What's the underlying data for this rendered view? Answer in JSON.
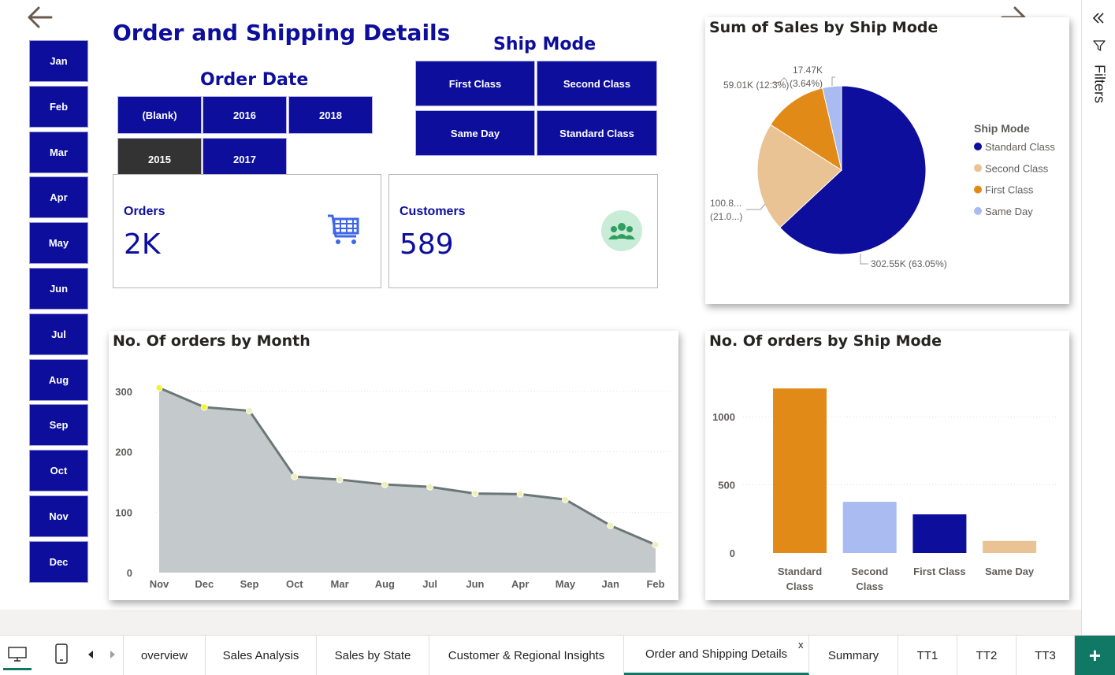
{
  "page_title": "Order and Shipping Details",
  "months": [
    "Jan",
    "Feb",
    "Mar",
    "Apr",
    "May",
    "Jun",
    "Jul",
    "Aug",
    "Sep",
    "Oct",
    "Nov",
    "Dec"
  ],
  "order_date": {
    "title": "Order Date",
    "options": [
      "(Blank)",
      "2016",
      "2018",
      "2015",
      "2017"
    ],
    "selected": "2015"
  },
  "ship_mode": {
    "title": "Ship Mode",
    "options": [
      "First Class",
      "Second Class",
      "Same Day",
      "Standard Class"
    ]
  },
  "cards": {
    "orders": {
      "label": "Orders",
      "value": "2K",
      "icon": "shopping-cart-icon"
    },
    "customers": {
      "label": "Customers",
      "value": "589",
      "icon": "people-group-icon"
    }
  },
  "charts": {
    "pie_title": "Sum of Sales by Ship Mode",
    "line_title": "No. Of orders by Month",
    "bar_title": "No. Of orders by Ship Mode"
  },
  "chart_data": [
    {
      "type": "pie",
      "title": "Sum of Sales by Ship Mode",
      "legend_title": "Ship Mode",
      "legend_position": "right",
      "slices": [
        {
          "label": "Standard Class",
          "value": 302.55,
          "pct": 63.05,
          "color": "#0d0e9c",
          "text": "302.55K (63.05%)"
        },
        {
          "label": "Second Class",
          "value": 100.8,
          "pct": 21.0,
          "color": "#eac395",
          "text": "100.8...",
          "text2": "(21.0...)"
        },
        {
          "label": "First Class",
          "value": 59.01,
          "pct": 12.3,
          "color": "#e28a18",
          "text": "59.01K (12.3%)"
        },
        {
          "label": "Same Day",
          "value": 17.47,
          "pct": 3.64,
          "color": "#a9bbf0",
          "text": "17.47K",
          "text2": "(3.64%)"
        }
      ]
    },
    {
      "type": "area",
      "title": "No. Of orders by Month",
      "categories": [
        "Nov",
        "Dec",
        "Sep",
        "Oct",
        "Mar",
        "Aug",
        "Jul",
        "Jun",
        "Apr",
        "May",
        "Jan",
        "Feb"
      ],
      "values": [
        306,
        274,
        268,
        159,
        154,
        146,
        142,
        131,
        130,
        121,
        78,
        46
      ],
      "yticks": [
        0,
        100,
        200,
        300
      ],
      "ylim": [
        0,
        330
      ],
      "grid": true
    },
    {
      "type": "bar",
      "title": "No. Of orders by Ship Mode",
      "categories": [
        "Standard Class",
        "Second Class",
        "First Class",
        "Same Day"
      ],
      "values": [
        1207,
        375,
        283,
        88
      ],
      "colors": [
        "#e28a18",
        "#a9bbf0",
        "#0d0e9c",
        "#eac395"
      ],
      "yticks": [
        0,
        500,
        1000
      ],
      "ylim": [
        0,
        1270
      ],
      "grid": true
    }
  ],
  "right_pane": {
    "label": "Filters"
  },
  "tabs": [
    {
      "label": "overview"
    },
    {
      "label": "Sales Analysis"
    },
    {
      "label": "Sales by State"
    },
    {
      "label": "Customer & Regional Insights"
    },
    {
      "label": "Order and Shipping Details",
      "active": true
    },
    {
      "label": "Summary"
    },
    {
      "label": "TT1"
    },
    {
      "label": "TT2"
    },
    {
      "label": "TT3"
    }
  ],
  "tab_close": "x",
  "add_page": "+"
}
